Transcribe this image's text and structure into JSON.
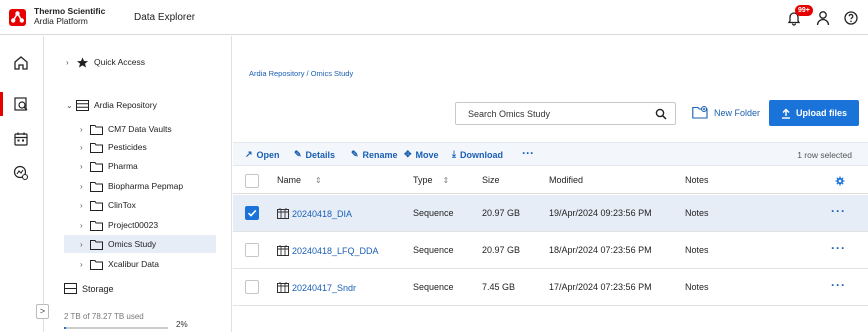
{
  "header": {
    "brand_line1": "Thermo Scientific",
    "brand_line2": "Ardia Platform",
    "app_name": "Data Explorer",
    "notification_count": "99+"
  },
  "rail": {
    "icons": [
      "home-icon",
      "data-explorer-icon",
      "calendar-icon",
      "analytics-icon"
    ]
  },
  "tree": {
    "items": [
      {
        "label": "Quick Access"
      },
      {
        "label": "Ardia Repository"
      },
      {
        "label": "CM7 Data Vaults"
      },
      {
        "label": "Pesticides"
      },
      {
        "label": "Pharma"
      },
      {
        "label": "Biopharma Pepmap"
      },
      {
        "label": "ClinTox"
      },
      {
        "label": "Project00023"
      },
      {
        "label": "Omics Study"
      },
      {
        "label": "Xcalibur Data"
      }
    ],
    "storage": {
      "title": "Storage",
      "used_text": "2 TB of 78.27 TB used",
      "percent_text": "2%",
      "used_fraction": 0.02
    },
    "collapse_glyph": ">"
  },
  "main": {
    "breadcrumb": "Ardia Repository  /  Omics Study",
    "search_placeholder": "Search Omics Study",
    "new_folder_label": "New Folder",
    "upload_label": "Upload files",
    "toolbar": {
      "open": "Open",
      "details": "Details",
      "rename": "Rename",
      "move": "Move",
      "download": "Download",
      "more": "···",
      "selection": "1 row selected"
    },
    "columns": {
      "name": "Name",
      "type": "Type",
      "size": "Size",
      "modified": "Modified",
      "notes": "Notes"
    },
    "rows": [
      {
        "name": "20240418_DIA",
        "type": "Sequence",
        "size": "20.97 GB",
        "modified": "19/Apr/2024 09:23:56 PM",
        "notes": "Notes",
        "selected": true
      },
      {
        "name": "20240418_LFQ_DDA",
        "type": "Sequence",
        "size": "20.97 GB",
        "modified": "18/Apr/2024 07:23:56 PM",
        "notes": "Notes",
        "selected": false
      },
      {
        "name": "20240417_Sndr",
        "type": "Sequence",
        "size": "7.45 GB",
        "modified": "17/Apr/2024 07:23:56 PM",
        "notes": "Notes",
        "selected": false
      }
    ],
    "row_more": "···"
  },
  "colors": {
    "brand_red": "#e60000",
    "accent_blue": "#1a73d9",
    "link_blue": "#1a5fb4",
    "selected_row": "#e6edf7"
  }
}
